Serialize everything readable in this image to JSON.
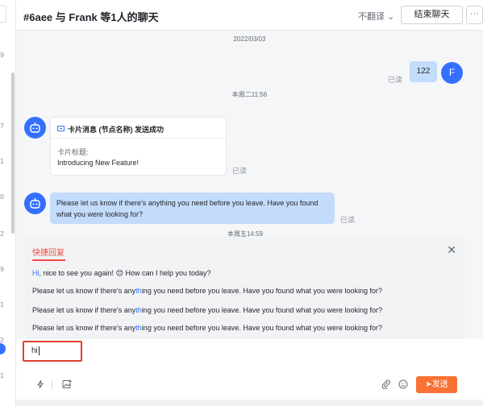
{
  "header": {
    "title": "#6aee 与 Frank 等1人的聊天",
    "translate_label": "不翻译",
    "end_chat_label": "结束聊天",
    "more_label": "···"
  },
  "left_strip": {
    "numbers": [
      "9",
      "7",
      "1",
      "0",
      "2",
      "9",
      "1",
      "2",
      "1"
    ]
  },
  "messages": {
    "date_1": "2022/03/03",
    "user_msg": "122",
    "user_avatar": "F",
    "read_1": "已读",
    "time_2": "本周二11:56",
    "card_title": "卡片消息 (节点名称) 发送成功",
    "card_label": "卡片标题:",
    "card_value": "Introducing New Feature!",
    "read_2": "已读",
    "bot_msg": "Please let us know if there's anything you need before you leave. Have you found what you were looking for?",
    "read_3": "已读",
    "time_3": "本周五14:59"
  },
  "quick_reply": {
    "tab_label": "快捷回复",
    "close_label": "✕",
    "items": [
      {
        "pre": "",
        "hl": "Hi",
        "post": ", nice to see you again! 😊 How can I help you today?"
      },
      {
        "pre": "Please let us know if there's any",
        "hl": "th",
        "post": "ing you need before you leave. Have you found what you were looking for?"
      },
      {
        "pre": "Please let us know if there's any",
        "hl": "th",
        "post": "ing you need before you leave. Have you found what you were looking for?"
      },
      {
        "pre": "Please let us know if there's any",
        "hl": "th",
        "post": "ing you need before you leave. Have you found what you were looking for?"
      }
    ]
  },
  "input": {
    "value": "hi",
    "send_label": "发送"
  },
  "icons": {
    "quick": "lightning-icon",
    "image": "image-icon",
    "attach": "paperclip-icon",
    "emoji": "smiley-icon",
    "send": "send-icon"
  },
  "colors": {
    "accent": "#3370ff",
    "send": "#f77234",
    "highlight_border": "#e03e2d",
    "bubble": "#c4dcfb"
  }
}
